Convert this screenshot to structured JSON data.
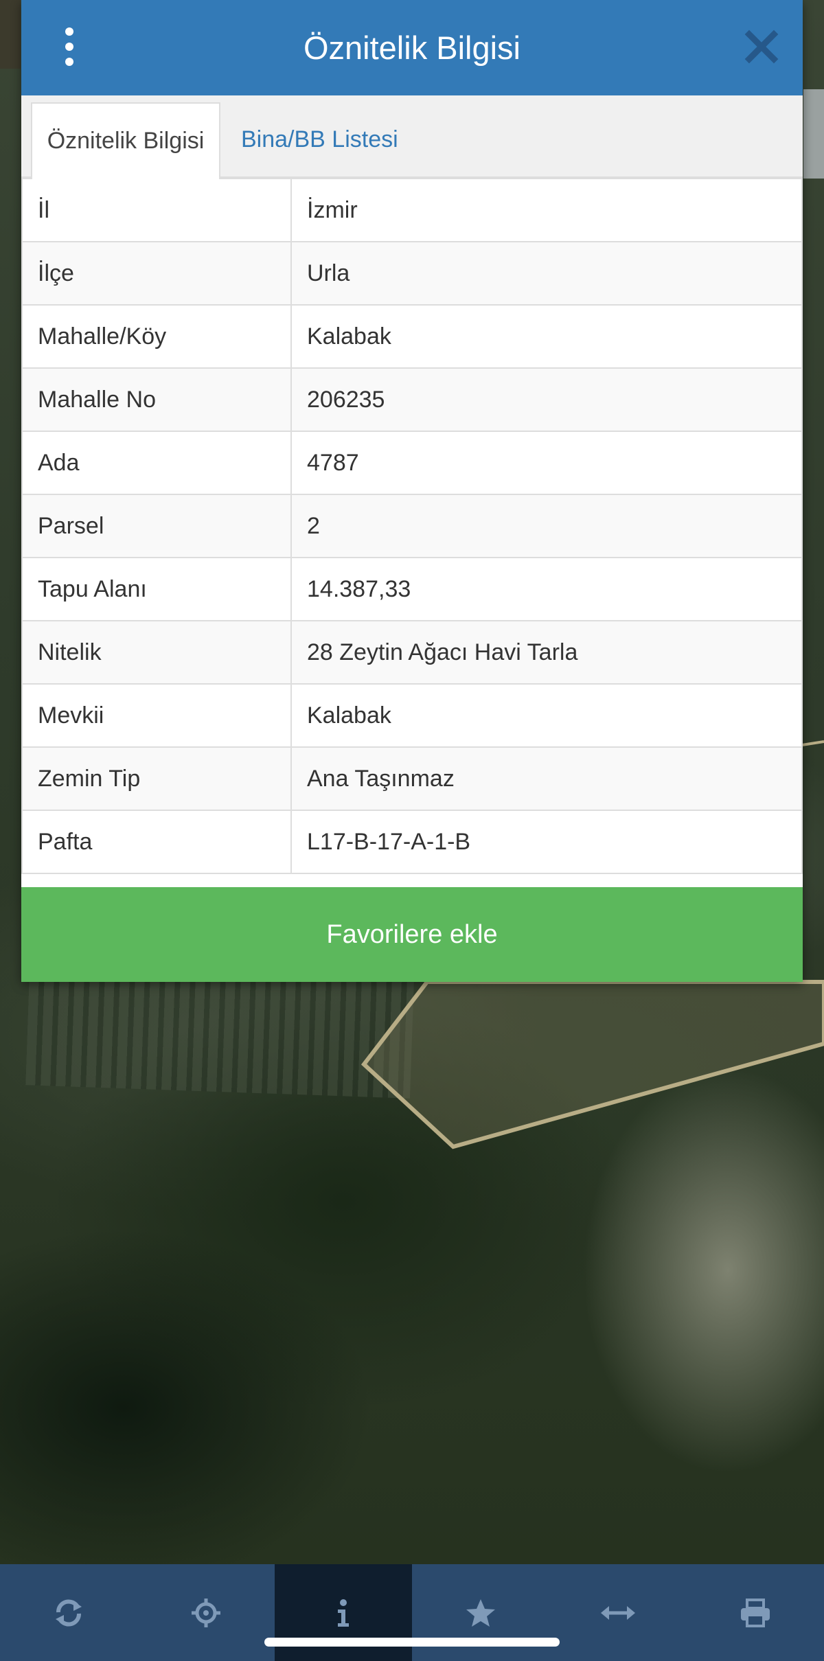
{
  "panel": {
    "title": "Öznitelik Bilgisi",
    "favorite_button_label": "Favorilere ekle"
  },
  "tabs": [
    {
      "label": "Öznitelik Bilgisi",
      "active": true
    },
    {
      "label": "Bina/BB Listesi",
      "active": false
    }
  ],
  "attributes": [
    {
      "key": "İl",
      "value": "İzmir"
    },
    {
      "key": "İlçe",
      "value": "Urla"
    },
    {
      "key": "Mahalle/Köy",
      "value": "Kalabak"
    },
    {
      "key": "Mahalle No",
      "value": "206235"
    },
    {
      "key": "Ada",
      "value": "4787"
    },
    {
      "key": "Parsel",
      "value": "2"
    },
    {
      "key": "Tapu Alanı",
      "value": "14.387,33"
    },
    {
      "key": "Nitelik",
      "value": "28 Zeytin Ağacı Havi Tarla"
    },
    {
      "key": "Mevkii",
      "value": "Kalabak"
    },
    {
      "key": "Zemin Tip",
      "value": "Ana Taşınmaz"
    },
    {
      "key": "Pafta",
      "value": "L17-B-17-A-1-B"
    }
  ],
  "toolbar": {
    "items": [
      {
        "icon": "refresh-icon",
        "active": false
      },
      {
        "icon": "locate-icon",
        "active": false
      },
      {
        "icon": "info-icon",
        "active": true
      },
      {
        "icon": "star-icon",
        "active": false
      },
      {
        "icon": "measure-icon",
        "active": false
      },
      {
        "icon": "print-icon",
        "active": false
      }
    ]
  },
  "colors": {
    "header": "#337ab7",
    "favorite_button": "#5cb85c",
    "toolbar": "#2b4a6d",
    "toolbar_active": "#0f1e2e",
    "toolbar_icon": "#7f9ab8",
    "parcel_outline": "#b8ad86"
  }
}
